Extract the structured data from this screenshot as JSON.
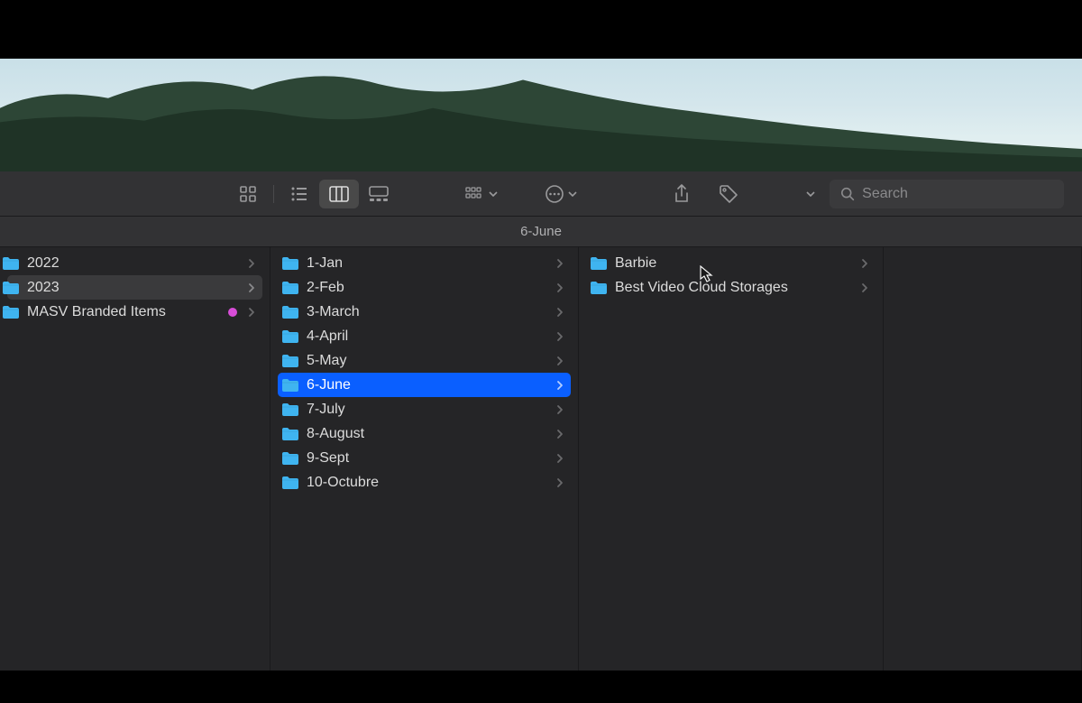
{
  "toolbar": {
    "search_placeholder": "Search"
  },
  "path": {
    "current_folder": "6-June"
  },
  "columns": [
    {
      "items": [
        {
          "label": "2022",
          "type": "folder",
          "selected": false,
          "browsed": false,
          "has_children": true,
          "tag": null
        },
        {
          "label": "2023",
          "type": "folder",
          "selected": false,
          "browsed": true,
          "has_children": true,
          "tag": null
        },
        {
          "label": "MASV Branded Items",
          "type": "folder",
          "selected": false,
          "browsed": false,
          "has_children": true,
          "tag": "#d84dd8"
        }
      ]
    },
    {
      "items": [
        {
          "label": "1-Jan",
          "type": "folder",
          "selected": false,
          "browsed": false,
          "has_children": true,
          "tag": null
        },
        {
          "label": "2-Feb",
          "type": "folder",
          "selected": false,
          "browsed": false,
          "has_children": true,
          "tag": null
        },
        {
          "label": "3-March",
          "type": "folder",
          "selected": false,
          "browsed": false,
          "has_children": true,
          "tag": null
        },
        {
          "label": "4-April",
          "type": "folder",
          "selected": false,
          "browsed": false,
          "has_children": true,
          "tag": null
        },
        {
          "label": "5-May",
          "type": "folder",
          "selected": false,
          "browsed": false,
          "has_children": true,
          "tag": null
        },
        {
          "label": "6-June",
          "type": "folder",
          "selected": true,
          "browsed": false,
          "has_children": true,
          "tag": null
        },
        {
          "label": "7-July",
          "type": "folder",
          "selected": false,
          "browsed": false,
          "has_children": true,
          "tag": null
        },
        {
          "label": "8-August",
          "type": "folder",
          "selected": false,
          "browsed": false,
          "has_children": true,
          "tag": null
        },
        {
          "label": "9-Sept",
          "type": "folder",
          "selected": false,
          "browsed": false,
          "has_children": true,
          "tag": null
        },
        {
          "label": "10-Octubre",
          "type": "folder",
          "selected": false,
          "browsed": false,
          "has_children": true,
          "tag": null
        }
      ]
    },
    {
      "items": [
        {
          "label": "Barbie",
          "type": "folder",
          "selected": false,
          "browsed": false,
          "has_children": true,
          "tag": null
        },
        {
          "label": "Best Video Cloud Storages",
          "type": "folder",
          "selected": false,
          "browsed": false,
          "has_children": true,
          "tag": null
        }
      ]
    },
    {
      "items": []
    }
  ],
  "colors": {
    "selection": "#0a5fff",
    "folder_icon": "#3fb4f0"
  }
}
